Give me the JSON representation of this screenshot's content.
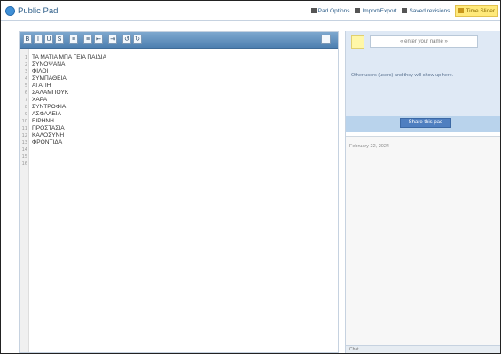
{
  "app": {
    "title": "Public Pad"
  },
  "nav": [
    {
      "label": "Pad Options",
      "icon": "options-icon"
    },
    {
      "label": "Import/Export",
      "icon": "import-export-icon"
    },
    {
      "label": "Saved revisions",
      "icon": "revisions-icon"
    },
    {
      "label": "Time Slider",
      "icon": "time-slider-icon",
      "active": true
    }
  ],
  "toolbar": {
    "buttons": [
      "B",
      "I",
      "U",
      "S",
      "≡",
      "≡",
      "⇤",
      "⇥",
      "↺",
      "↻"
    ]
  },
  "editor": {
    "lines": [
      "ΤΑ ΜΑΤΙΑ ΜΠΑ ΓΕΙΑ ΠΑΙΔΙΑ",
      "ΣΥΝΟΨΑΝΑ",
      "ΦΙΛΟΙ",
      "ΣΥΜΠΑΘΕΙΑ",
      "ΑΓΑΠΗ",
      "ΣΑΛΑΜΠΟΥΚ",
      "ΧΑΡΑ",
      "ΣΥΝΤΡΟΦΙΑ",
      "ΑΣΦΑΛΕΙΑ",
      "ΕΙΡΗΝΗ",
      "ΠΡΟΣΤΑΣΙΑ",
      "ΚΑΛΟΣΥΝΗ",
      "ΦΡΟΝΤΙΔΑ"
    ],
    "line_numbers": [
      "1",
      "2",
      "3",
      "4",
      "5",
      "6",
      "7",
      "8",
      "9",
      "10",
      "11",
      "12",
      "13",
      "14",
      "15",
      "16"
    ]
  },
  "sidebar": {
    "name_placeholder": "« enter your name »",
    "other_users_text": "Other users (users) and they will show up here.",
    "share_label": "Share this pad",
    "chat_date": "February 22, 2024",
    "chat_label": "Chat"
  },
  "colors": {
    "accent": "#4f7fc0",
    "active_nav": "#ffe97a",
    "user_swatch": "#fff7a8"
  }
}
